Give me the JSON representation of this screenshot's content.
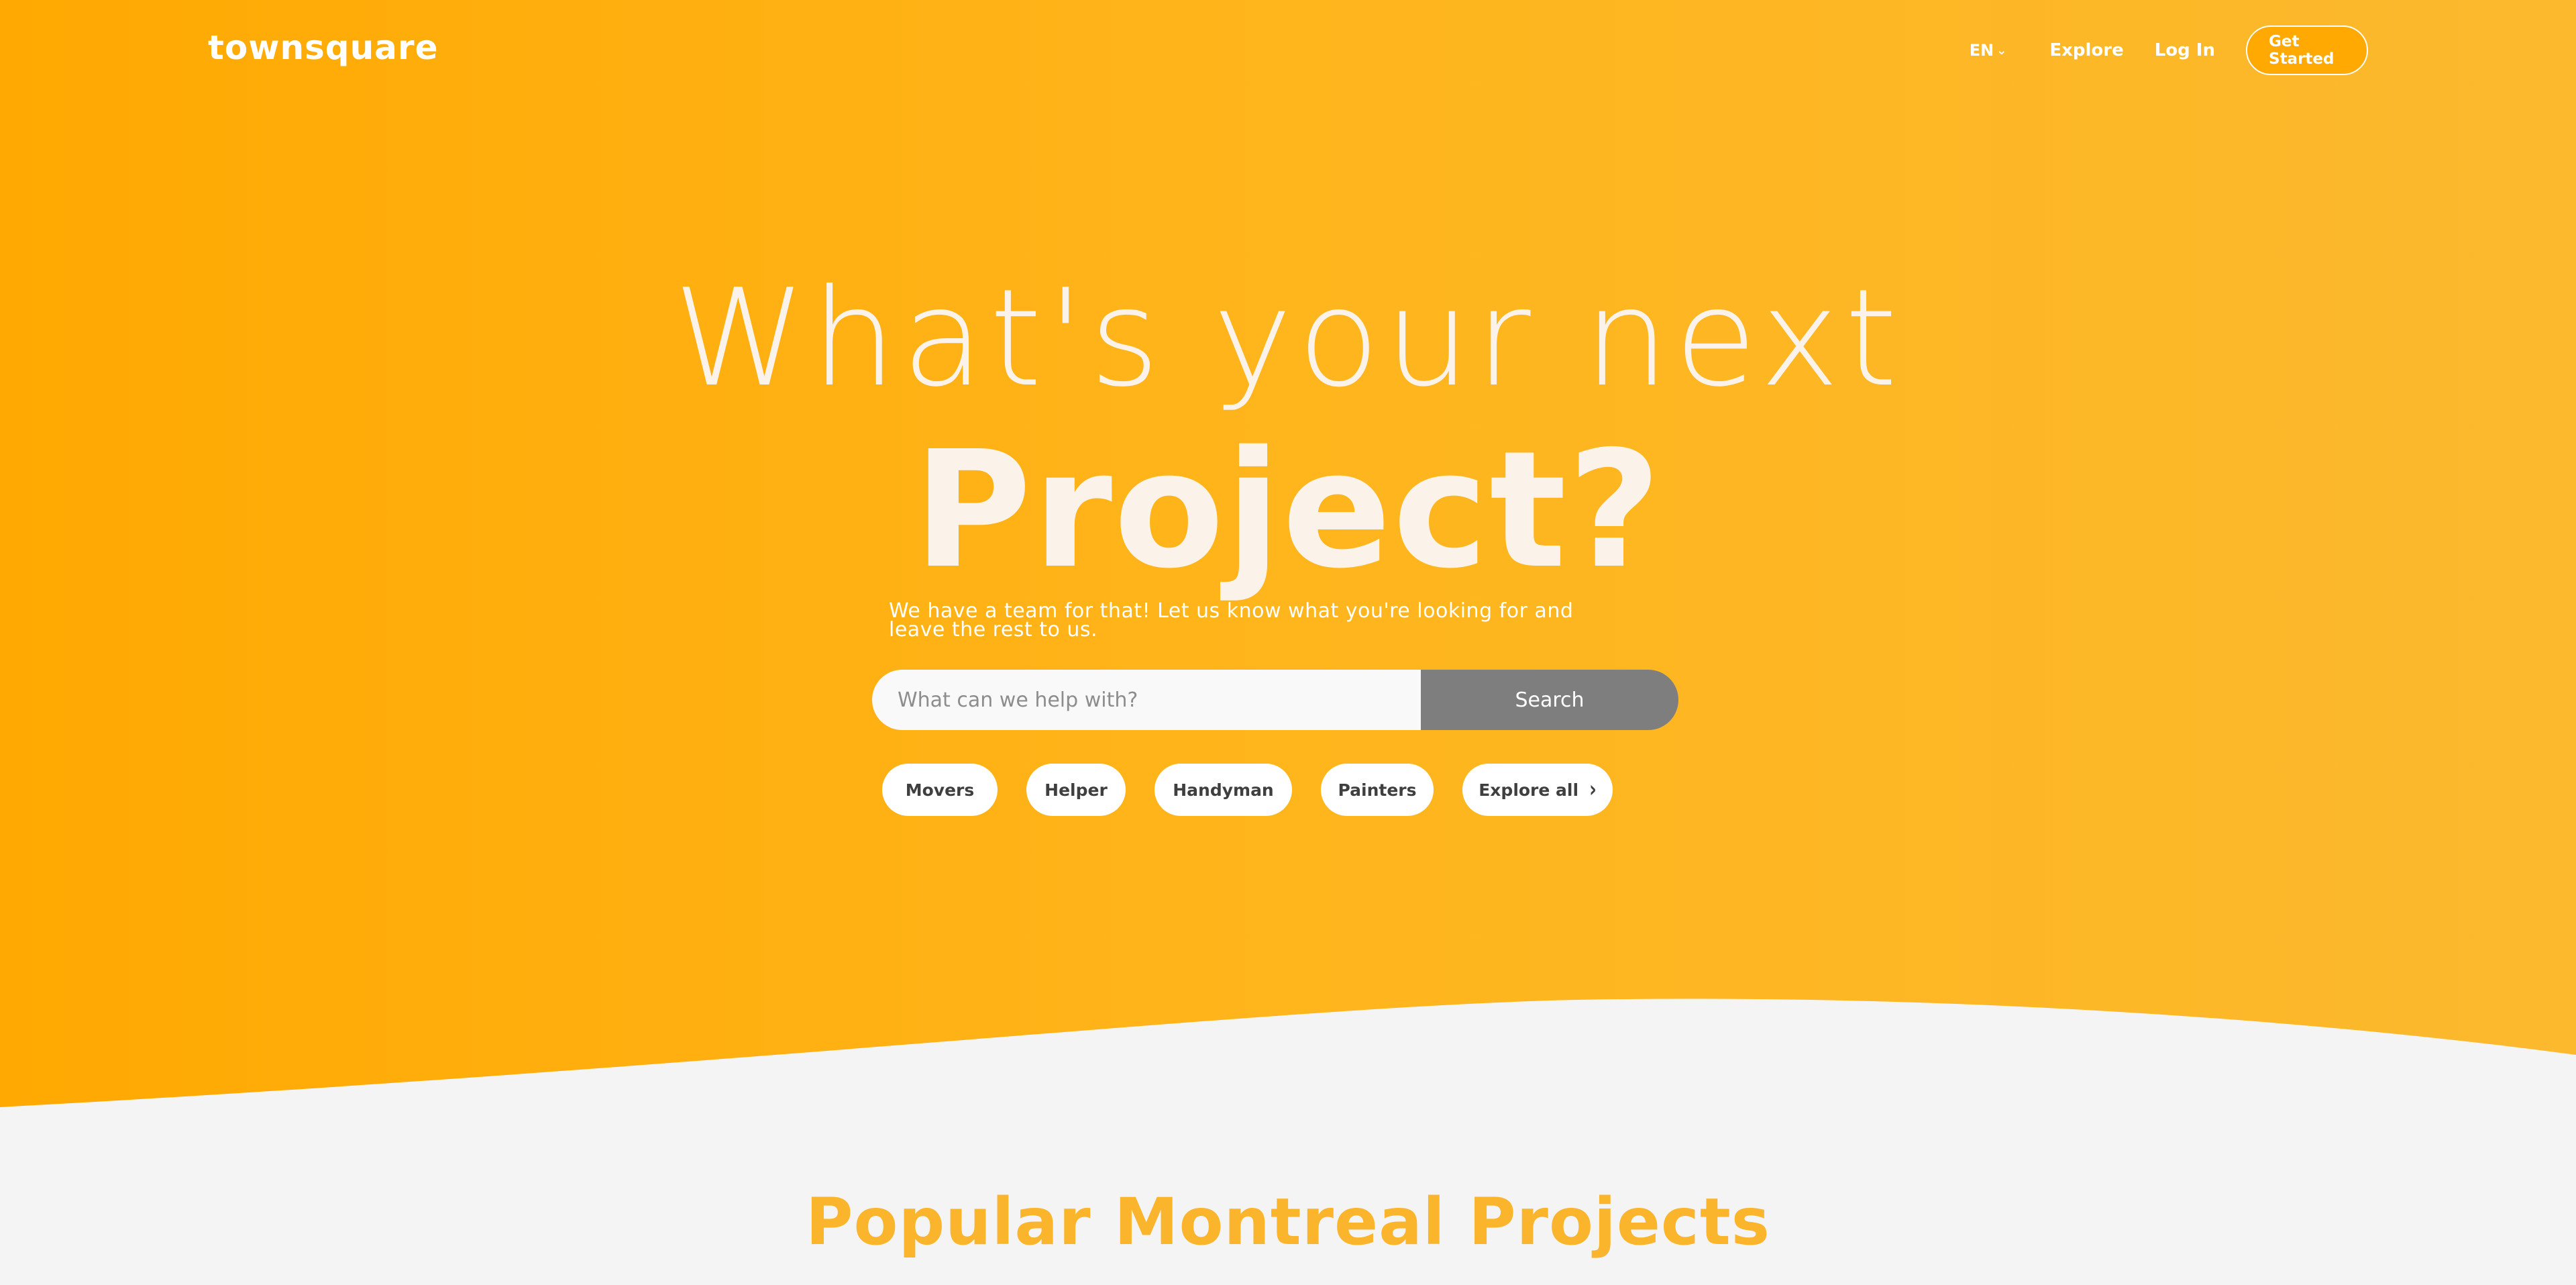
{
  "brand": {
    "logo": "townsquare"
  },
  "nav": {
    "language": "EN",
    "explore": "Explore",
    "login": "Log In",
    "cta": "Get Started"
  },
  "hero": {
    "headline_line1": "What's your next",
    "headline_line2": "Project?",
    "subtext": "We have a team for that! Let us know what you're looking for and leave the rest to us."
  },
  "search": {
    "placeholder": "What can we help with?",
    "button_label": "Search"
  },
  "chips": [
    {
      "label": "Movers"
    },
    {
      "label": "Helper"
    },
    {
      "label": "Handyman"
    },
    {
      "label": "Painters"
    },
    {
      "label": "Explore all"
    }
  ],
  "section": {
    "title": "Popular Montreal Projects"
  },
  "colors": {
    "hero_start": "#ffa902",
    "hero_end": "#fcb92e",
    "search_button": "#7e7e7e",
    "section_title": "#fbb52d",
    "background": "#f4f4f4"
  }
}
